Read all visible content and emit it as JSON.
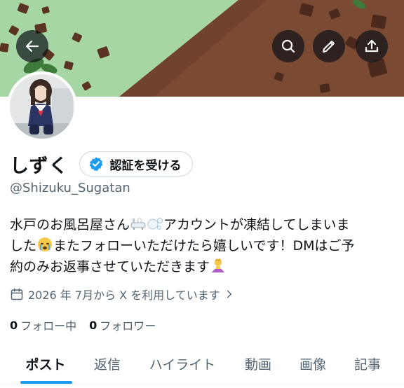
{
  "header": {
    "back_icon": "arrow-left-icon",
    "search_icon": "search-icon",
    "edit_icon": "pencil-icon",
    "share_icon": "share-icon"
  },
  "profile": {
    "display_name": "しずく",
    "verify_button_label": "認証を受ける",
    "handle": "@Shizuku_Sugatan",
    "bio_parts": {
      "line1": "水戸のお風呂屋さん",
      "line1b": "アカウントが凍結してしまいま",
      "line2a": "した",
      "line2b": "またフォローいただけたら嬉しいです！DMはご予",
      "line3": "約のみお返事させていただきます"
    },
    "joined_text": "2026 年 7月から X を利用しています",
    "following_count": "0",
    "following_label": "フォロー中",
    "followers_count": "0",
    "followers_label": "フォロワー"
  },
  "tabs": [
    {
      "label": "ポスト",
      "active": true
    },
    {
      "label": "返信",
      "active": false
    },
    {
      "label": "ハイライト",
      "active": false
    },
    {
      "label": "動画",
      "active": false
    },
    {
      "label": "画像",
      "active": false
    },
    {
      "label": "記事",
      "active": false
    }
  ],
  "colors": {
    "accent": "#1d9bf0",
    "banner_green": "#a6d6a4",
    "banner_brown": "#7b4a33",
    "text_primary": "#0f1419",
    "text_secondary": "#536471"
  }
}
